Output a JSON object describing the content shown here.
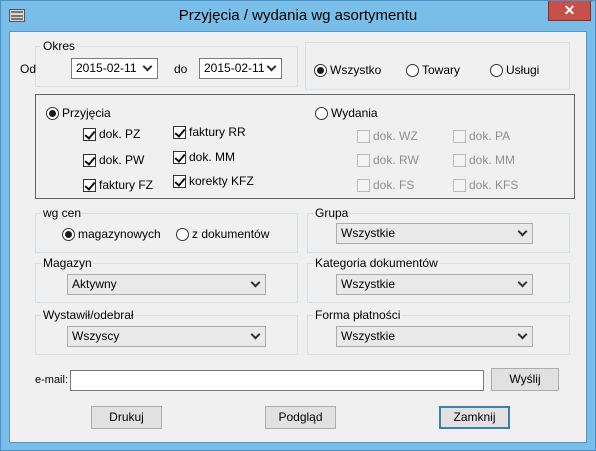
{
  "window": {
    "title": "Przyjęcia / wydania wg asortymentu",
    "close_glyph": "✕"
  },
  "okres": {
    "legend": "Okres",
    "from_label": "Od",
    "from_value": "2015-02-11",
    "to_label": "do",
    "to_value": "2015-02-11"
  },
  "scope": {
    "options": [
      {
        "label": "Wszystko",
        "selected": true
      },
      {
        "label": "Towary",
        "selected": false
      },
      {
        "label": "Usługi",
        "selected": false
      }
    ]
  },
  "przyjecia": {
    "label": "Przyjęcia",
    "selected": true,
    "docs": [
      {
        "label": "dok. PZ",
        "checked": true
      },
      {
        "label": "dok. PW",
        "checked": true
      },
      {
        "label": "faktury FZ",
        "checked": true
      },
      {
        "label": "faktury RR",
        "checked": true
      },
      {
        "label": "dok. MM",
        "checked": true
      },
      {
        "label": "korekty KFZ",
        "checked": true
      }
    ]
  },
  "wydania": {
    "label": "Wydania",
    "selected": false,
    "docs": [
      {
        "label": "dok. WZ",
        "checked": false
      },
      {
        "label": "dok. RW",
        "checked": false
      },
      {
        "label": "dok. FS",
        "checked": false
      },
      {
        "label": "dok. PA",
        "checked": false
      },
      {
        "label": "dok. MM",
        "checked": false
      },
      {
        "label": "dok. KFS",
        "checked": false
      }
    ]
  },
  "wg_cen": {
    "legend": "wg cen",
    "options": [
      {
        "label": "magazynowych",
        "selected": true
      },
      {
        "label": "z dokumentów",
        "selected": false
      }
    ]
  },
  "grupa": {
    "legend": "Grupa",
    "value": "Wszystkie"
  },
  "magazyn": {
    "legend": "Magazyn",
    "value": "Aktywny"
  },
  "kategoria": {
    "legend": "Kategoria dokumentów",
    "value": "Wszystkie"
  },
  "wystawil": {
    "legend": "Wystawił/odebrał",
    "value": "Wszyscy"
  },
  "forma": {
    "legend": "Forma płatności",
    "value": "Wszystkie"
  },
  "email": {
    "label": "e-mail:",
    "value": "",
    "send_label": "Wyślij"
  },
  "buttons": {
    "print": "Drukuj",
    "preview": "Podgląd",
    "close": "Zamknij"
  }
}
